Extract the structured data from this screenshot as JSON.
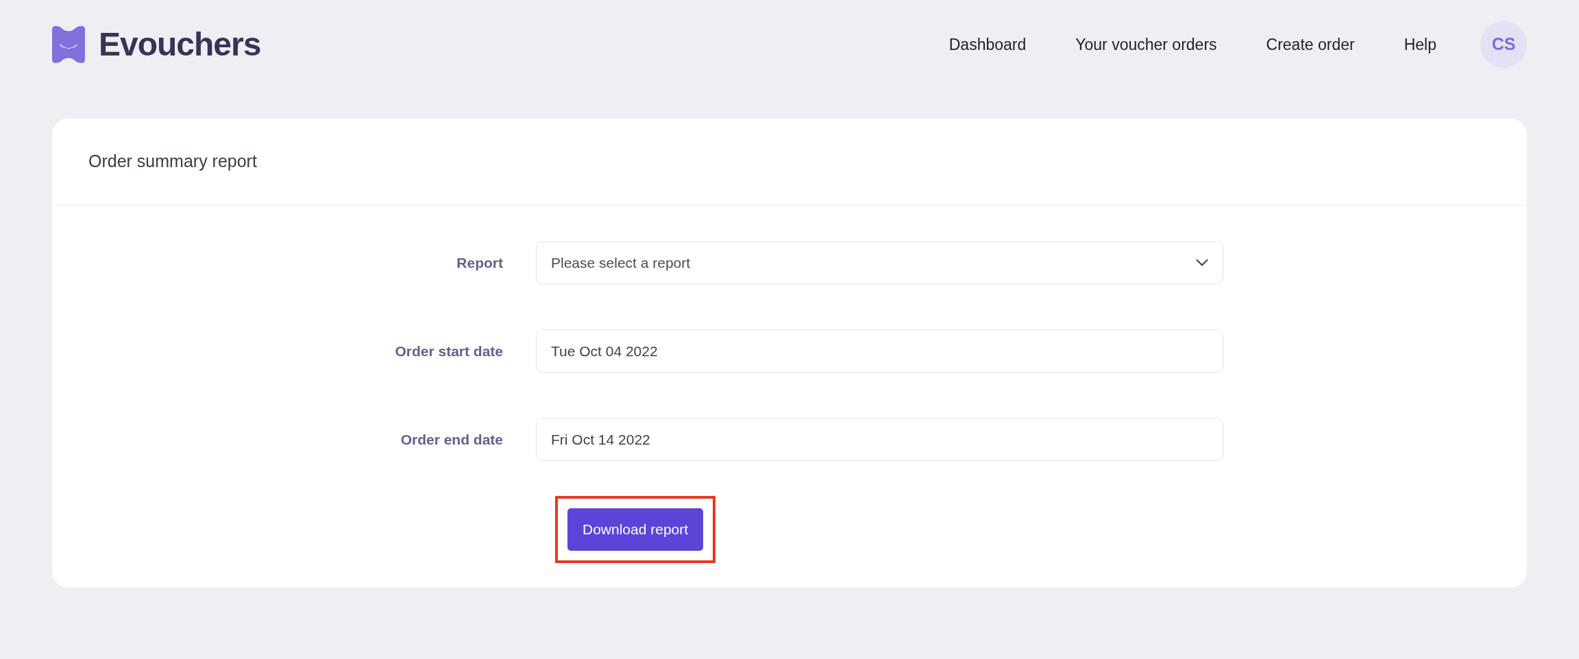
{
  "brand": {
    "name": "Evouchers"
  },
  "nav": [
    {
      "label": "Dashboard"
    },
    {
      "label": "Your voucher orders"
    },
    {
      "label": "Create order"
    },
    {
      "label": "Help"
    }
  ],
  "avatar": {
    "initials": "CS"
  },
  "card": {
    "title": "Order summary report",
    "fields": [
      {
        "kind": "select",
        "label": "Report",
        "placeholder": "Please select a report"
      },
      {
        "kind": "text",
        "label": "Order start date",
        "value": "Tue Oct 04 2022"
      },
      {
        "kind": "text",
        "label": "Order end date",
        "value": "Fri Oct 14 2022"
      }
    ],
    "button": {
      "label": "Download report",
      "highlighted": true
    }
  }
}
